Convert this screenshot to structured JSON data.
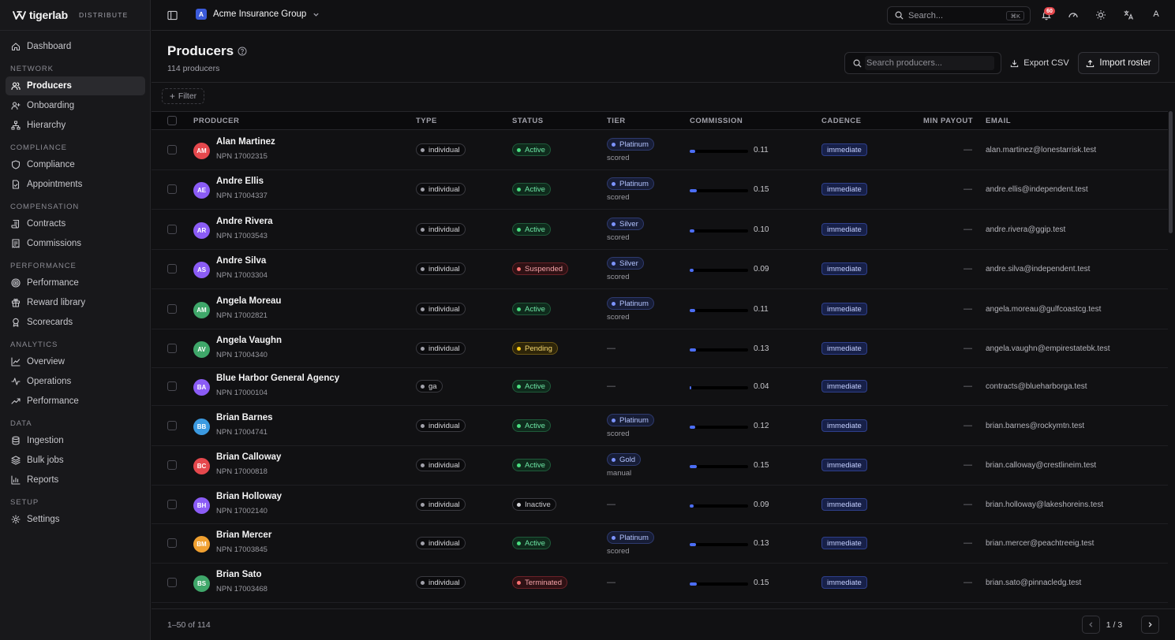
{
  "app": {
    "brand": "tigerlab",
    "product": "DISTRIBUTE",
    "org_initial": "A",
    "org_name": "Acme Insurance Group",
    "search_placeholder": "Search...",
    "search_shortcut": "⌘K",
    "notifications_count": "60",
    "user_initial": "A",
    "accent_color": "#4c6ef5"
  },
  "sidebar": {
    "top": [
      {
        "label": "Dashboard",
        "icon": "home-icon"
      }
    ],
    "sections": [
      {
        "title": "NETWORK",
        "items": [
          {
            "label": "Producers",
            "icon": "users-icon",
            "active": true
          },
          {
            "label": "Onboarding",
            "icon": "user-plus-icon"
          },
          {
            "label": "Hierarchy",
            "icon": "network-icon"
          }
        ]
      },
      {
        "title": "COMPLIANCE",
        "items": [
          {
            "label": "Compliance",
            "icon": "shield-icon"
          },
          {
            "label": "Appointments",
            "icon": "file-check-icon"
          }
        ]
      },
      {
        "title": "COMPENSATION",
        "items": [
          {
            "label": "Contracts",
            "icon": "scroll-icon"
          },
          {
            "label": "Commissions",
            "icon": "receipt-icon"
          }
        ]
      },
      {
        "title": "PERFORMANCE",
        "items": [
          {
            "label": "Performance",
            "icon": "target-icon"
          },
          {
            "label": "Reward library",
            "icon": "gift-icon"
          },
          {
            "label": "Scorecards",
            "icon": "award-icon"
          }
        ]
      },
      {
        "title": "ANALYTICS",
        "items": [
          {
            "label": "Overview",
            "icon": "line-chart-icon"
          },
          {
            "label": "Operations",
            "icon": "activity-icon"
          },
          {
            "label": "Performance",
            "icon": "trending-up-icon"
          }
        ]
      },
      {
        "title": "DATA",
        "items": [
          {
            "label": "Ingestion",
            "icon": "database-icon"
          },
          {
            "label": "Bulk jobs",
            "icon": "layers-icon"
          },
          {
            "label": "Reports",
            "icon": "bar-chart-icon"
          }
        ]
      },
      {
        "title": "SETUP",
        "items": [
          {
            "label": "Settings",
            "icon": "gear-icon"
          }
        ]
      }
    ]
  },
  "page": {
    "title": "Producers",
    "subtitle": "114 producers",
    "search_placeholder": "Search producers...",
    "export_label": "Export CSV",
    "import_label": "Import roster",
    "filter_label": "Filter"
  },
  "table": {
    "columns": {
      "producer": "PRODUCER",
      "type": "TYPE",
      "status": "STATUS",
      "tier": "TIER",
      "commission": "COMMISSION",
      "cadence": "CADENCE",
      "min_payout": "MIN PAYOUT",
      "email": "EMAIL"
    },
    "rows": [
      {
        "initials": "AM",
        "avatar_color": "#e5484d",
        "name": "Alan Martinez",
        "npn": "NPN 17002315",
        "type": "individual",
        "status": "Active",
        "tier": "Platinum",
        "tier_source": "scored",
        "commission": 0.11,
        "commission_label": "0.11",
        "cadence": "immediate",
        "min_payout": "—",
        "email": "alan.martinez@lonestarrisk.test"
      },
      {
        "initials": "AE",
        "avatar_color": "#8b5cf6",
        "name": "Andre Ellis",
        "npn": "NPN 17004337",
        "type": "individual",
        "status": "Active",
        "tier": "Platinum",
        "tier_source": "scored",
        "commission": 0.15,
        "commission_label": "0.15",
        "cadence": "immediate",
        "min_payout": "—",
        "email": "andre.ellis@independent.test"
      },
      {
        "initials": "AR",
        "avatar_color": "#8b5cf6",
        "name": "Andre Rivera",
        "npn": "NPN 17003543",
        "type": "individual",
        "status": "Active",
        "tier": "Silver",
        "tier_source": "scored",
        "commission": 0.1,
        "commission_label": "0.10",
        "cadence": "immediate",
        "min_payout": "—",
        "email": "andre.rivera@ggip.test"
      },
      {
        "initials": "AS",
        "avatar_color": "#8b5cf6",
        "name": "Andre Silva",
        "npn": "NPN 17003304",
        "type": "individual",
        "status": "Suspended",
        "tier": "Silver",
        "tier_source": "scored",
        "commission": 0.09,
        "commission_label": "0.09",
        "cadence": "immediate",
        "min_payout": "—",
        "email": "andre.silva@independent.test"
      },
      {
        "initials": "AM",
        "avatar_color": "#3fa76a",
        "name": "Angela Moreau",
        "npn": "NPN 17002821",
        "type": "individual",
        "status": "Active",
        "tier": "Platinum",
        "tier_source": "scored",
        "commission": 0.11,
        "commission_label": "0.11",
        "cadence": "immediate",
        "min_payout": "—",
        "email": "angela.moreau@gulfcoastcg.test"
      },
      {
        "initials": "AV",
        "avatar_color": "#3fa76a",
        "name": "Angela Vaughn",
        "npn": "NPN 17004340",
        "type": "individual",
        "status": "Pending",
        "tier": "—",
        "tier_source": "",
        "commission": 0.13,
        "commission_label": "0.13",
        "cadence": "immediate",
        "min_payout": "—",
        "email": "angela.vaughn@empirestatebk.test"
      },
      {
        "initials": "BA",
        "avatar_color": "#8b5cf6",
        "name": "Blue Harbor General Agency",
        "npn": "NPN 17000104",
        "type": "ga",
        "status": "Active",
        "tier": "—",
        "tier_source": "",
        "commission": 0.04,
        "commission_label": "0.04",
        "cadence": "immediate",
        "min_payout": "—",
        "email": "contracts@blueharborga.test"
      },
      {
        "initials": "BB",
        "avatar_color": "#3b9ae1",
        "name": "Brian Barnes",
        "npn": "NPN 17004741",
        "type": "individual",
        "status": "Active",
        "tier": "Platinum",
        "tier_source": "scored",
        "commission": 0.12,
        "commission_label": "0.12",
        "cadence": "immediate",
        "min_payout": "—",
        "email": "brian.barnes@rockymtn.test"
      },
      {
        "initials": "BC",
        "avatar_color": "#e5484d",
        "name": "Brian Calloway",
        "npn": "NPN 17000818",
        "type": "individual",
        "status": "Active",
        "tier": "Gold",
        "tier_source": "manual",
        "commission": 0.15,
        "commission_label": "0.15",
        "cadence": "immediate",
        "min_payout": "—",
        "email": "brian.calloway@crestlineim.test"
      },
      {
        "initials": "BH",
        "avatar_color": "#8b5cf6",
        "name": "Brian Holloway",
        "npn": "NPN 17002140",
        "type": "individual",
        "status": "Inactive",
        "tier": "—",
        "tier_source": "",
        "commission": 0.09,
        "commission_label": "0.09",
        "cadence": "immediate",
        "min_payout": "—",
        "email": "brian.holloway@lakeshoreins.test"
      },
      {
        "initials": "BM",
        "avatar_color": "#f0a030",
        "name": "Brian Mercer",
        "npn": "NPN 17003845",
        "type": "individual",
        "status": "Active",
        "tier": "Platinum",
        "tier_source": "scored",
        "commission": 0.13,
        "commission_label": "0.13",
        "cadence": "immediate",
        "min_payout": "—",
        "email": "brian.mercer@peachtreeig.test"
      },
      {
        "initials": "BS",
        "avatar_color": "#3fa76a",
        "name": "Brian Sato",
        "npn": "NPN 17003468",
        "type": "individual",
        "status": "Terminated",
        "tier": "—",
        "tier_source": "",
        "commission": 0.15,
        "commission_label": "0.15",
        "cadence": "immediate",
        "min_payout": "—",
        "email": "brian.sato@pinnacledg.test"
      }
    ]
  },
  "footer": {
    "range": "1–50 of 114",
    "page": "1 / 3"
  }
}
